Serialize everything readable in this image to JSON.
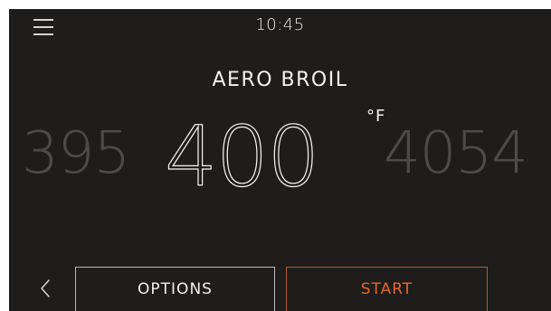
{
  "status_bar": {
    "time": "10:45",
    "menu_icon": "hamburger-menu-icon"
  },
  "mode": {
    "title": "AERO BROIL"
  },
  "temperature": {
    "unit": "°F",
    "previous": "395",
    "current": "400",
    "next": "405",
    "next_partial": "4"
  },
  "footer": {
    "back_icon": "chevron-left-icon",
    "options_label": "OPTIONS",
    "start_label": "START"
  },
  "colors": {
    "background": "#1e1d1c",
    "accent": "#e8642a",
    "text": "#f4f2ef",
    "dim_text": "#4d4b49"
  }
}
